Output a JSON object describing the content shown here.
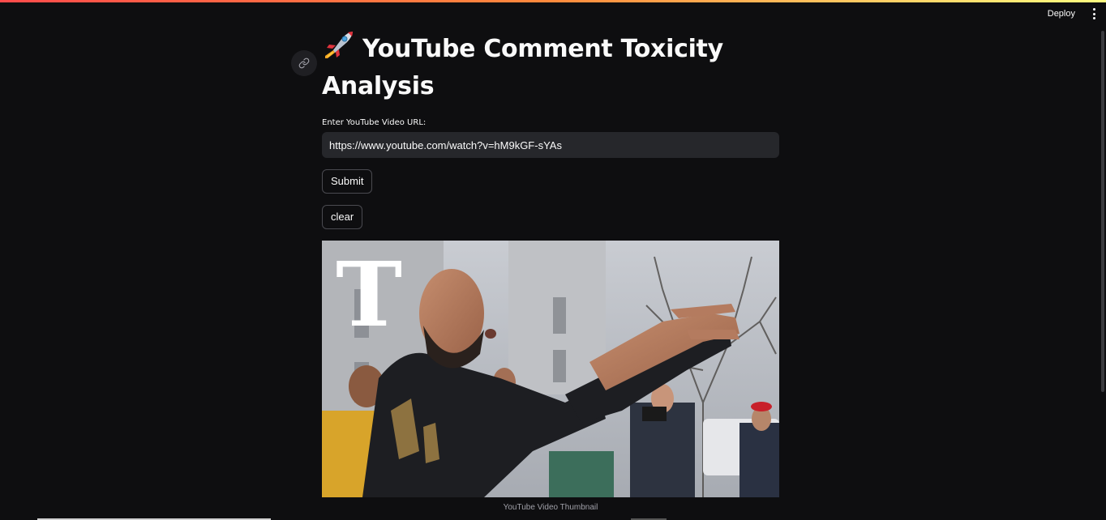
{
  "header": {
    "deploy_label": "Deploy",
    "menu_icon": "kebab-menu-icon"
  },
  "page": {
    "title": "YouTube Comment Toxicity Analysis",
    "title_icon": "rocket-icon",
    "anchor_icon": "link-icon"
  },
  "form": {
    "url_label": "Enter YouTube Video URL:",
    "url_value": "https://www.youtube.com/watch?v=hM9kGF-sYAs",
    "submit_label": "Submit",
    "clear_label": "clear"
  },
  "thumbnail": {
    "caption": "YouTube Video Thumbnail",
    "logo_letter": "T"
  },
  "colors": {
    "background": "#0e0e10",
    "input_bg": "#26272b",
    "accent_gradient_start": "#ff4b4b",
    "accent_gradient_end": "#fffd80"
  }
}
